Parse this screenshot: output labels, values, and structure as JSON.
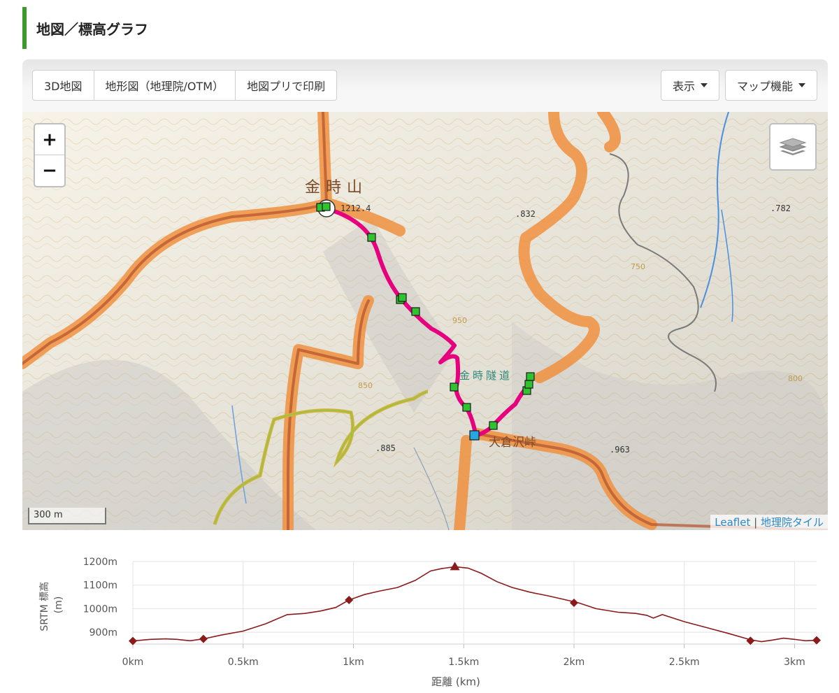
{
  "section": {
    "title": "地図／標高グラフ"
  },
  "toolbar": {
    "left_buttons": [
      "3D地図",
      "地形図（地理院/OTM）",
      "地図プリで印刷"
    ],
    "display_label": "表示",
    "map_functions_label": "マップ機能"
  },
  "map": {
    "zoom_in": "+",
    "zoom_out": "−",
    "scale_label": "300 m",
    "attribution": {
      "leaflet": "Leaflet",
      "separator": "|",
      "tiles": "地理院タイル"
    },
    "labels": {
      "mountain": "金時山",
      "summit_elev": "1212.4",
      "pass": "大倉沢峠",
      "tunnel": "金時隧道",
      "spot_832": ".832",
      "spot_782": ".782",
      "spot_885": ".885",
      "spot_963": ".963",
      "contour_950": "950",
      "contour_850": "850",
      "contour_750": "750",
      "contour_800": "800"
    },
    "colors": {
      "route": "#e6007e",
      "waypoint": "#2fc32f",
      "start": "#25a8e0",
      "trail": "#e8742d"
    }
  },
  "chart_data": {
    "type": "line",
    "xlabel": "距離 (km)",
    "ylabel": "SRTM 標高 (m)",
    "ylabel_parts": [
      "SRTM 標高",
      "(m)"
    ],
    "x_ticks": [
      "0km",
      "0.5km",
      "1km",
      "1.5km",
      "2km",
      "2.5km",
      "3km"
    ],
    "x_tick_values": [
      0,
      0.5,
      1,
      1.5,
      2,
      2.5,
      3
    ],
    "y_ticks": [
      "900m",
      "1000m",
      "1100m",
      "1200m"
    ],
    "y_tick_values": [
      900,
      1000,
      1100,
      1200
    ],
    "xlim": [
      0,
      3.1
    ],
    "ylim": [
      850,
      1200
    ],
    "grid": true,
    "line_color": "#8b1a1a",
    "series": [
      {
        "x": [
          0,
          0.08,
          0.15,
          0.2,
          0.26,
          0.32,
          0.4,
          0.5,
          0.6,
          0.7,
          0.78,
          0.85,
          0.92,
          0.98,
          1.05,
          1.12,
          1.2,
          1.28,
          1.35,
          1.4,
          1.46,
          1.52,
          1.58,
          1.65,
          1.72,
          1.8,
          1.88,
          1.95,
          2.02,
          2.1,
          2.2,
          2.28,
          2.33,
          2.36,
          2.4,
          2.45,
          2.5,
          2.6,
          2.7,
          2.8,
          2.85,
          2.9,
          2.95,
          3.0,
          3.05,
          3.1
        ],
        "y": [
          863,
          870,
          872,
          870,
          864,
          872,
          888,
          905,
          935,
          975,
          980,
          990,
          1005,
          1037,
          1060,
          1075,
          1090,
          1120,
          1160,
          1170,
          1178,
          1172,
          1150,
          1115,
          1090,
          1070,
          1055,
          1040,
          1025,
          1000,
          985,
          980,
          972,
          960,
          975,
          960,
          945,
          920,
          895,
          868,
          860,
          867,
          875,
          870,
          864,
          866
        ]
      }
    ],
    "markers": {
      "diamonds": [
        [
          0,
          863
        ],
        [
          0.32,
          872
        ],
        [
          0.98,
          1037
        ],
        [
          2.0,
          1025
        ],
        [
          2.8,
          864
        ],
        [
          3.1,
          866
        ]
      ],
      "triangle": [
        [
          1.46,
          1178
        ]
      ]
    }
  }
}
